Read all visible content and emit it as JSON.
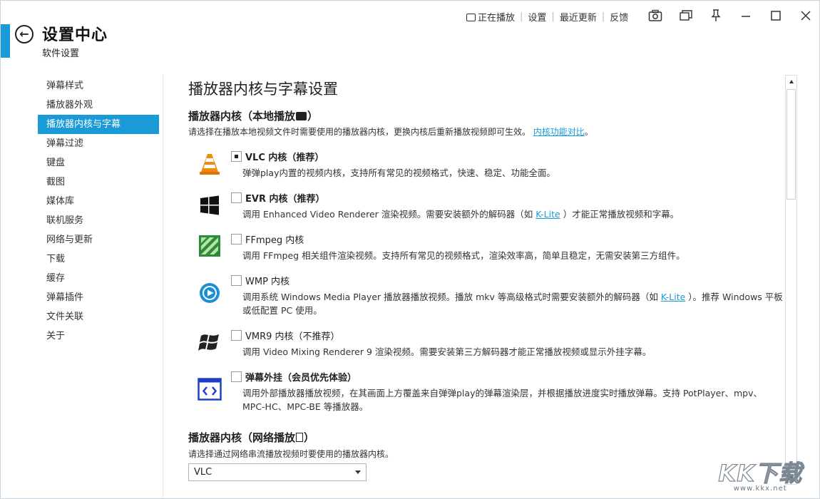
{
  "header": {
    "title": "设置中心",
    "subtitle": "软件设置",
    "links": [
      "正在播放",
      "设置",
      "最近更新",
      "反馈"
    ]
  },
  "colors": {
    "accent": "#1a9bd7",
    "link": "#1a9bd7"
  },
  "sidebar": {
    "items": [
      {
        "label": "弹幕样式"
      },
      {
        "label": "播放器外观"
      },
      {
        "label": "播放器内核与字幕",
        "active": true
      },
      {
        "label": "弹幕过滤"
      },
      {
        "label": "键盘"
      },
      {
        "label": "截图"
      },
      {
        "label": "媒体库"
      },
      {
        "label": "联机服务"
      },
      {
        "label": "网络与更新"
      },
      {
        "label": "下载"
      },
      {
        "label": "缓存"
      },
      {
        "label": "弹幕插件"
      },
      {
        "label": "文件关联"
      },
      {
        "label": "关于"
      }
    ]
  },
  "main": {
    "title": "播放器内核与字幕设置",
    "local": {
      "title": "播放器内核（本地播放",
      "desc": "请选择在播放本地视频文件时需要使用的播放器内核，更换内核后重新播放视频即可生效。",
      "desc_link": "内核功能对比",
      "desc_end": "。"
    },
    "options": [
      {
        "name": "VLC 内核（推荐）",
        "checked": true,
        "bold": true,
        "icon": "vlc-cone-icon",
        "desc": "弹弹play内置的视频内核，支持所有常见的视频格式，快速、稳定、功能全面。"
      },
      {
        "name": "EVR 内核（推荐）",
        "checked": false,
        "bold": true,
        "icon": "windows-icon",
        "desc_a": "调用 Enhanced Video Renderer 渲染视频。需要安装额外的解码器（如 ",
        "desc_link": "K-Lite",
        "desc_b": " ）才能正常播放视频和字幕。"
      },
      {
        "name": "FFmpeg 内核",
        "checked": false,
        "bold": false,
        "icon": "ffmpeg-icon",
        "desc": "调用 FFmpeg 相关组件渲染视频。支持所有常见的视频格式，渲染效率高，简单且稳定，无需安装第三方组件。"
      },
      {
        "name": "WMP 内核",
        "checked": false,
        "bold": false,
        "icon": "windows-media-player-icon",
        "desc_a": "调用系统 Windows Media Player 播放器播放视频。播放 mkv 等高级格式时需要安装额外的解码器（如 ",
        "desc_link": "K-Lite",
        "desc_b": " ）。推荐 Windows 平板或低配置 PC 使用。"
      },
      {
        "name": "VMR9 内核（不推荐）",
        "checked": false,
        "bold": false,
        "icon": "windows-flag-icon",
        "desc": "调用 Video Mixing Renderer 9 渲染视频。需要安装第三方解码器才能正常播放视频或显示外挂字幕。"
      },
      {
        "name": "弹幕外挂（会员优先体验）",
        "checked": false,
        "bold": true,
        "icon": "overlay-code-icon",
        "desc": "调用外部播放器播放视频，在其画面上方覆盖来自弹弹play的弹幕渲染层，并根据播放进度实时播放弹幕。支持 PotPlayer、mpv、MPC-HC、MPC-BE 等播放器。"
      }
    ],
    "network": {
      "title": "播放器内核（网络播放",
      "desc": "请选择通过网络串流播放视频时要使用的播放器内核。",
      "select_value": "VLC"
    }
  },
  "watermark": {
    "big": "KK下载",
    "small": "www.kkx.net"
  }
}
